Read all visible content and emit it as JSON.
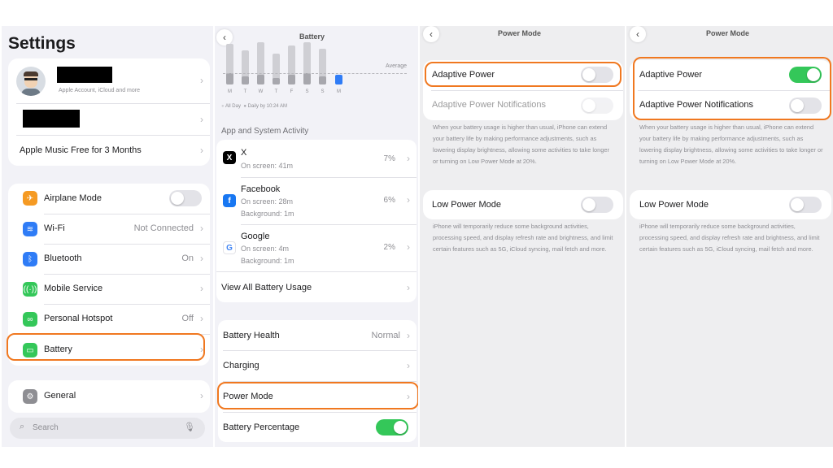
{
  "colors": {
    "highlight": "#f07820",
    "toggle_on": "#34c759",
    "accent_blue": "#2f7cf6"
  },
  "panel1": {
    "title": "Settings",
    "account_sub": "Apple Account, iCloud and more",
    "promo": "Apple Music Free for 3 Months",
    "items": [
      {
        "label": "Airplane Mode",
        "icon": "airplane-icon",
        "value": ""
      },
      {
        "label": "Wi-Fi",
        "icon": "wifi-icon",
        "value": "Not Connected"
      },
      {
        "label": "Bluetooth",
        "icon": "bluetooth-icon",
        "value": "On"
      },
      {
        "label": "Mobile Service",
        "icon": "antenna-icon",
        "value": ""
      },
      {
        "label": "Personal Hotspot",
        "icon": "hotspot-icon",
        "value": "Off"
      },
      {
        "label": "Battery",
        "icon": "battery-icon",
        "value": ""
      }
    ],
    "general": "General",
    "search_placeholder": "Search"
  },
  "panel2": {
    "title": "Battery",
    "average": "Average",
    "days": [
      "M",
      "T",
      "W",
      "T",
      "F",
      "S",
      "S",
      "M"
    ],
    "legend_all": "All Day",
    "legend_daily": "Daily by 10:24 AM",
    "section": "App and System Activity",
    "apps": [
      {
        "name": "X",
        "icon": "x-logo-icon",
        "line1": "On screen: 41m",
        "line2": "",
        "pct": "7%"
      },
      {
        "name": "Facebook",
        "icon": "facebook-icon",
        "line1": "On screen: 28m",
        "line2": "Background: 1m",
        "pct": "6%"
      },
      {
        "name": "Google",
        "icon": "google-icon",
        "line1": "On screen: 4m",
        "line2": "Background: 1m",
        "pct": "2%"
      }
    ],
    "view_all": "View All Battery Usage",
    "health": "Battery Health",
    "health_value": "Normal",
    "charging": "Charging",
    "power_mode": "Power Mode",
    "battery_pct": "Battery Percentage"
  },
  "panel3": {
    "title": "Power Mode",
    "adaptive": "Adaptive Power",
    "adaptive_notif": "Adaptive Power Notifications",
    "adaptive_note": "When your battery usage is higher than usual, iPhone can extend your battery life by making performance adjustments, such as lowering display brightness, allowing some activities to take longer or turning on Low Power Mode at 20%.",
    "low_power": "Low Power Mode",
    "low_power_note": "iPhone will temporarily reduce some background activities, processing speed, and display refresh rate and brightness, and limit certain features such as 5G, iCloud syncing, mail fetch and more."
  },
  "panel4": {
    "title": "Power Mode",
    "adaptive": "Adaptive Power",
    "adaptive_notif": "Adaptive Power Notifications",
    "adaptive_note": "When your battery usage is higher than usual, iPhone can extend your battery life by making performance adjustments, such as lowering display brightness, allowing some activities to take longer or turning on Low Power Mode at 20%.",
    "low_power": "Low Power Mode",
    "low_power_note": "iPhone will temporarily reduce some background activities, processing speed, and display refresh rate and brightness, and limit certain features such as 5G, iCloud syncing, mail fetch and more."
  }
}
